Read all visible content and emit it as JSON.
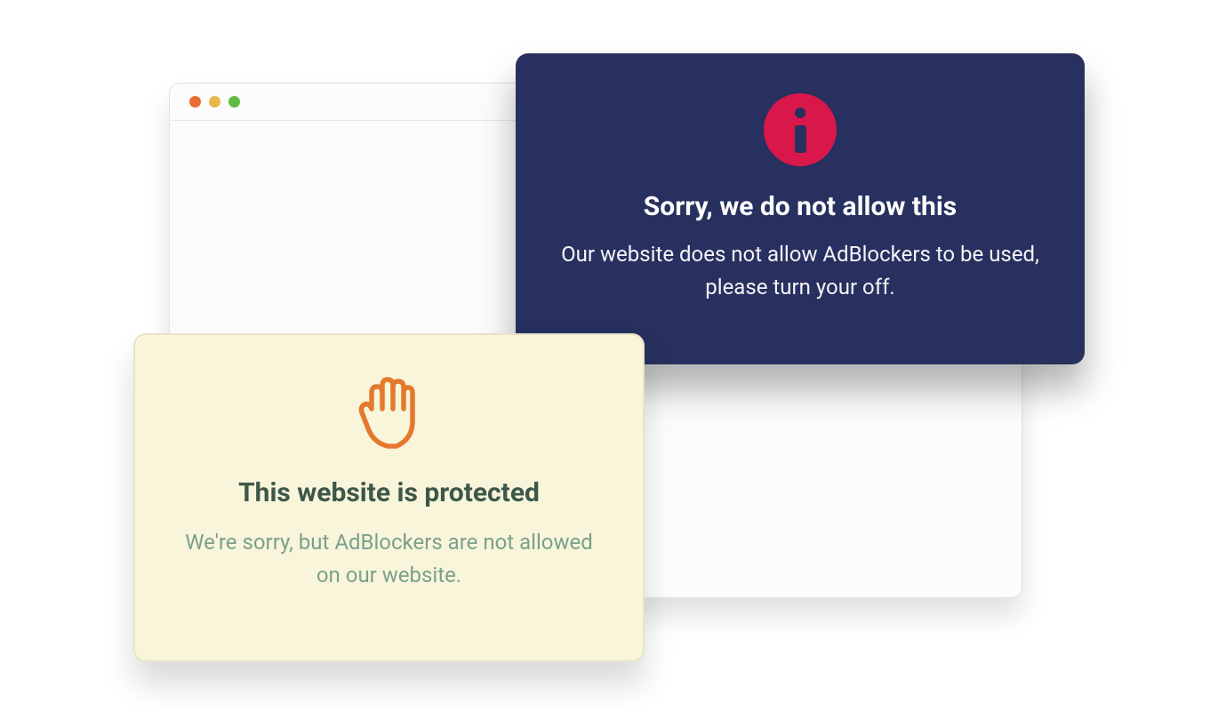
{
  "darkCard": {
    "title": "Sorry, we do not allow this",
    "body": "Our website does not allow AdBlockers to be used, please turn your off."
  },
  "lightCard": {
    "title": "This website is protected",
    "body": "We're sorry, but AdBlockers are not allowed on our website."
  },
  "colors": {
    "darkBg": "#28305f",
    "infoBadge": "#d9174a",
    "lightBg": "#f8f5da",
    "handStroke": "#e4792d",
    "greenTitle": "#3d574b",
    "greenBody": "#7ba08c"
  }
}
